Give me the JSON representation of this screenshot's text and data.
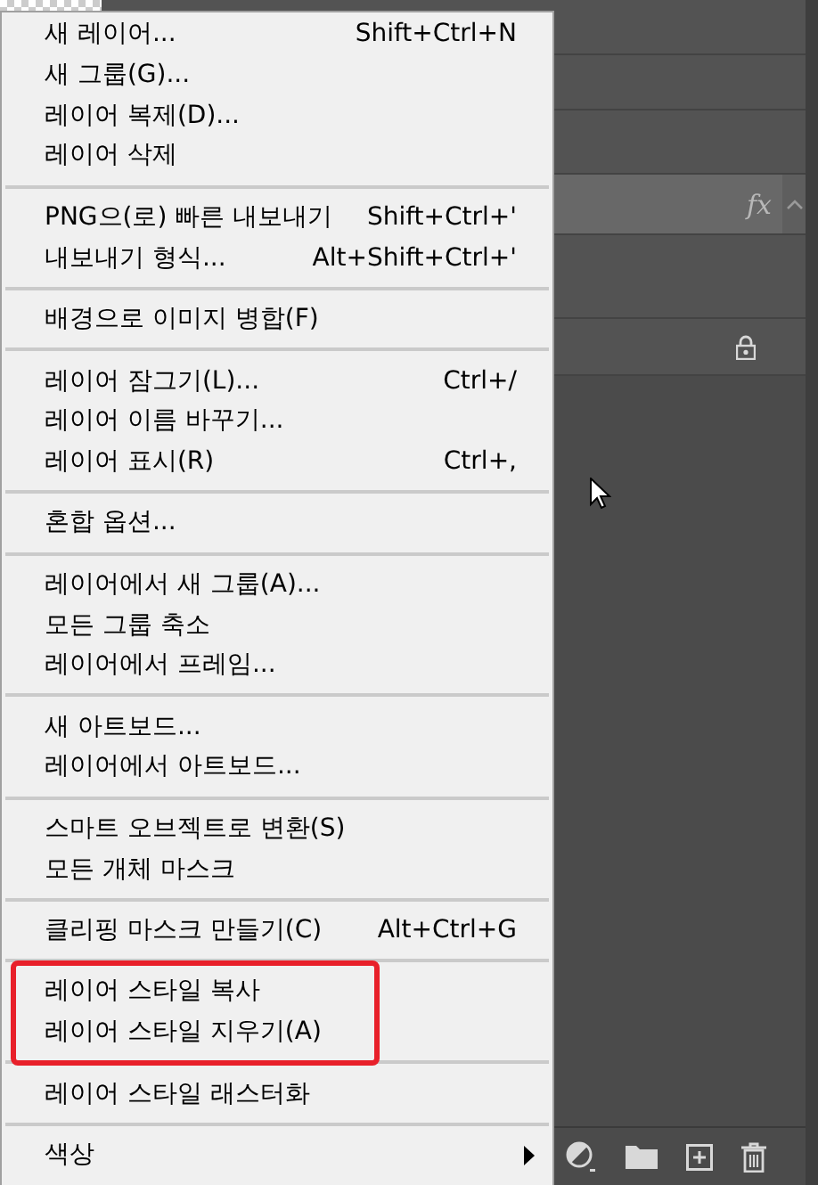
{
  "menu": {
    "groups": [
      {
        "highlighted": false,
        "items": [
          {
            "label": "새 레이어...",
            "shortcut": "Shift+Ctrl+N",
            "submenu": false
          },
          {
            "label": "새 그룹(G)...",
            "submenu": false
          },
          {
            "label": "레이어 복제(D)...",
            "submenu": false
          },
          {
            "label": "레이어 삭제",
            "submenu": false
          }
        ]
      },
      {
        "highlighted": false,
        "items": [
          {
            "label": "PNG으(로) 빠른 내보내기",
            "shortcut": "Shift+Ctrl+'",
            "submenu": false
          },
          {
            "label": "내보내기 형식...",
            "shortcut": "Alt+Shift+Ctrl+'",
            "submenu": false
          }
        ]
      },
      {
        "highlighted": false,
        "items": [
          {
            "label": "배경으로 이미지 병합(F)",
            "submenu": false
          }
        ]
      },
      {
        "highlighted": false,
        "items": [
          {
            "label": "레이어 잠그기(L)...",
            "shortcut": "Ctrl+/",
            "submenu": false
          },
          {
            "label": "레이어 이름 바꾸기...",
            "submenu": false
          },
          {
            "label": "레이어 표시(R)",
            "shortcut": "Ctrl+,",
            "submenu": false
          }
        ]
      },
      {
        "highlighted": false,
        "items": [
          {
            "label": "혼합 옵션...",
            "submenu": false
          }
        ]
      },
      {
        "highlighted": false,
        "items": [
          {
            "label": "레이어에서 새 그룹(A)...",
            "submenu": false
          },
          {
            "label": "모든 그룹 축소",
            "submenu": false
          },
          {
            "label": "레이어에서 프레임...",
            "submenu": false
          }
        ]
      },
      {
        "highlighted": false,
        "items": [
          {
            "label": "새 아트보드...",
            "submenu": false
          },
          {
            "label": "레이어에서 아트보드...",
            "submenu": false
          }
        ]
      },
      {
        "highlighted": false,
        "items": [
          {
            "label": "스마트 오브젝트로 변환(S)",
            "submenu": false
          },
          {
            "label": "모든 개체 마스크",
            "submenu": false
          }
        ]
      },
      {
        "highlighted": false,
        "items": [
          {
            "label": "클리핑 마스크 만들기(C)",
            "shortcut": "Alt+Ctrl+G",
            "submenu": false
          }
        ]
      },
      {
        "highlighted": true,
        "items": [
          {
            "label": "레이어 스타일 복사",
            "submenu": false
          },
          {
            "label": "레이어 스타일 지우기(A)",
            "submenu": false
          }
        ]
      },
      {
        "highlighted": false,
        "items": [
          {
            "label": "레이어 스타일 래스터화",
            "submenu": false
          }
        ]
      },
      {
        "highlighted": false,
        "items": [
          {
            "label": "색상",
            "submenu": true
          }
        ]
      }
    ]
  },
  "layers_panel": {
    "layers": [
      {
        "selected": false
      },
      {
        "selected": false
      },
      {
        "selected": false
      },
      {
        "selected": true,
        "effects_label": "fx"
      },
      {
        "selected": false
      },
      {
        "selected": false
      }
    ]
  }
}
